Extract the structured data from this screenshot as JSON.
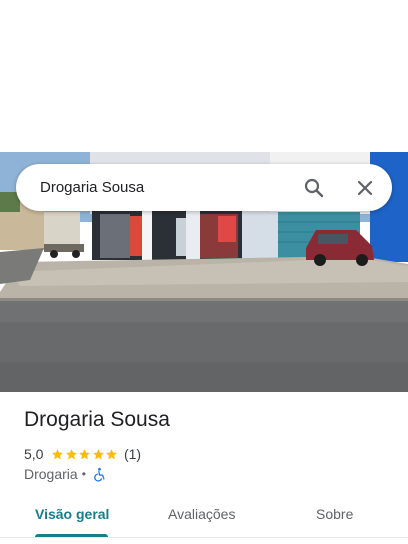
{
  "search": {
    "query": "Drogaria Sousa",
    "search_icon": "search-icon",
    "close_icon": "close-icon"
  },
  "photo": {
    "description_icon": "storefront-photo"
  },
  "place": {
    "name": "Drogaria Sousa",
    "rating_text": "5,0",
    "rating_value": 5.0,
    "stars_filled": 5,
    "stars_total": 5,
    "review_count": "(1)",
    "category": "Drogaria",
    "separator": "•",
    "accessibility_icon": "wheelchair-icon"
  },
  "tabs": [
    {
      "label": "Visão geral",
      "active": true
    },
    {
      "label": "Avaliações",
      "active": false
    },
    {
      "label": "Sobre",
      "active": false
    }
  ],
  "colors": {
    "accent": "#177d8a",
    "star": "#fbbc04",
    "wheelchair": "#1a73e8"
  }
}
